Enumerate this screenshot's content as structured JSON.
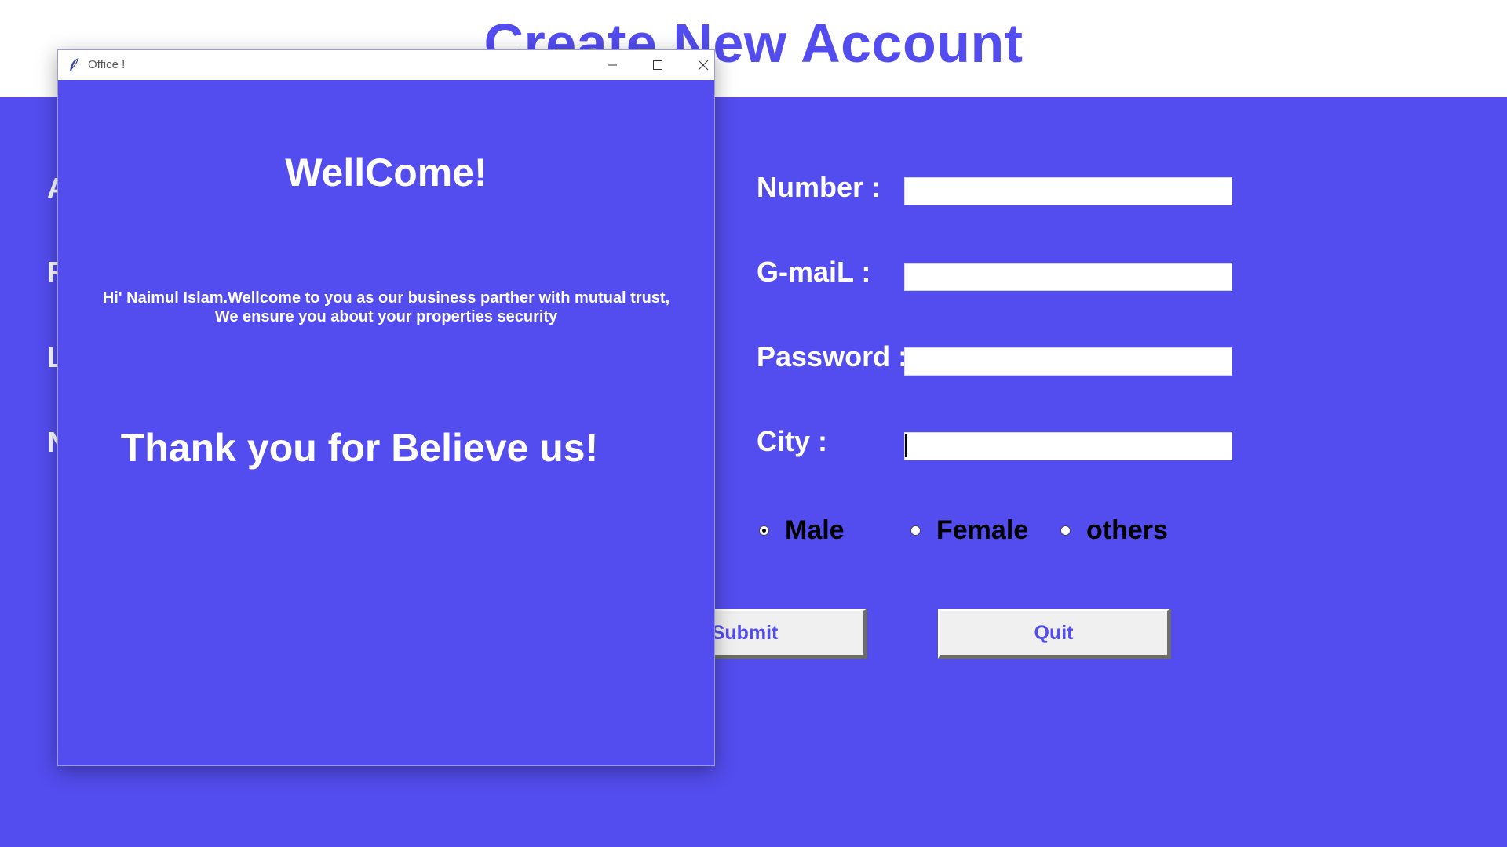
{
  "main": {
    "title": "Create New Account",
    "left_partial_letters": [
      "A",
      "F",
      "L",
      "N"
    ],
    "fields": [
      {
        "label": "Number :",
        "value": ""
      },
      {
        "label": "G-maiL :",
        "value": ""
      },
      {
        "label": "Password :",
        "value": ""
      },
      {
        "label": "City :",
        "value": ""
      }
    ],
    "gender": {
      "options": [
        "Male",
        "Female",
        "others"
      ],
      "selected": "Male"
    },
    "buttons": {
      "submit": "Submit",
      "quit": "Quit"
    }
  },
  "dialog": {
    "title": "Office !",
    "heading": "WellCome!",
    "message_line1": "Hi' Naimul Islam.Wellcome to you as our business parther with mutual trust,",
    "message_line2": "We ensure you about your properties security",
    "thanks": "Thank you for Believe us!"
  },
  "colors": {
    "accent": "#534cee",
    "white": "#ffffff"
  }
}
